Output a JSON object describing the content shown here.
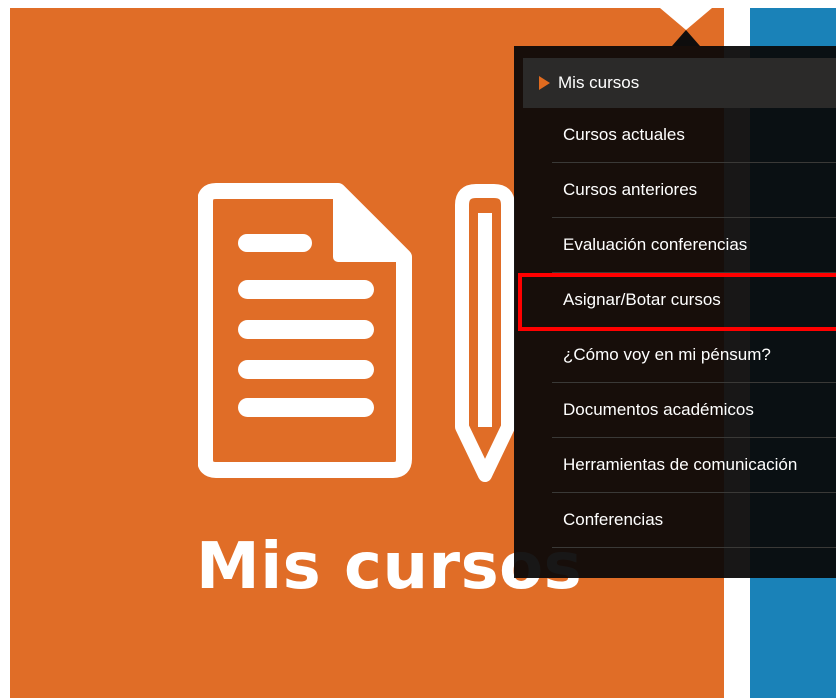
{
  "tile": {
    "title": "Mis cursos",
    "color": "#e06d27",
    "icons": [
      "document-icon",
      "pencil-icon"
    ]
  },
  "adjacent_tile": {
    "color": "#1a82b8"
  },
  "menu": {
    "header": "Mis cursos",
    "items": [
      {
        "label": "Cursos actuales"
      },
      {
        "label": "Cursos anteriores"
      },
      {
        "label": "Evaluación conferencias"
      },
      {
        "label": "Asignar/Botar cursos",
        "highlighted": true
      },
      {
        "label": "¿Cómo voy en mi pénsum?"
      },
      {
        "label": "Documentos académicos"
      },
      {
        "label": "Herramientas de comunicación"
      },
      {
        "label": "Conferencias"
      }
    ],
    "highlight_color": "#ff0000",
    "accent": "#e06b1f"
  }
}
